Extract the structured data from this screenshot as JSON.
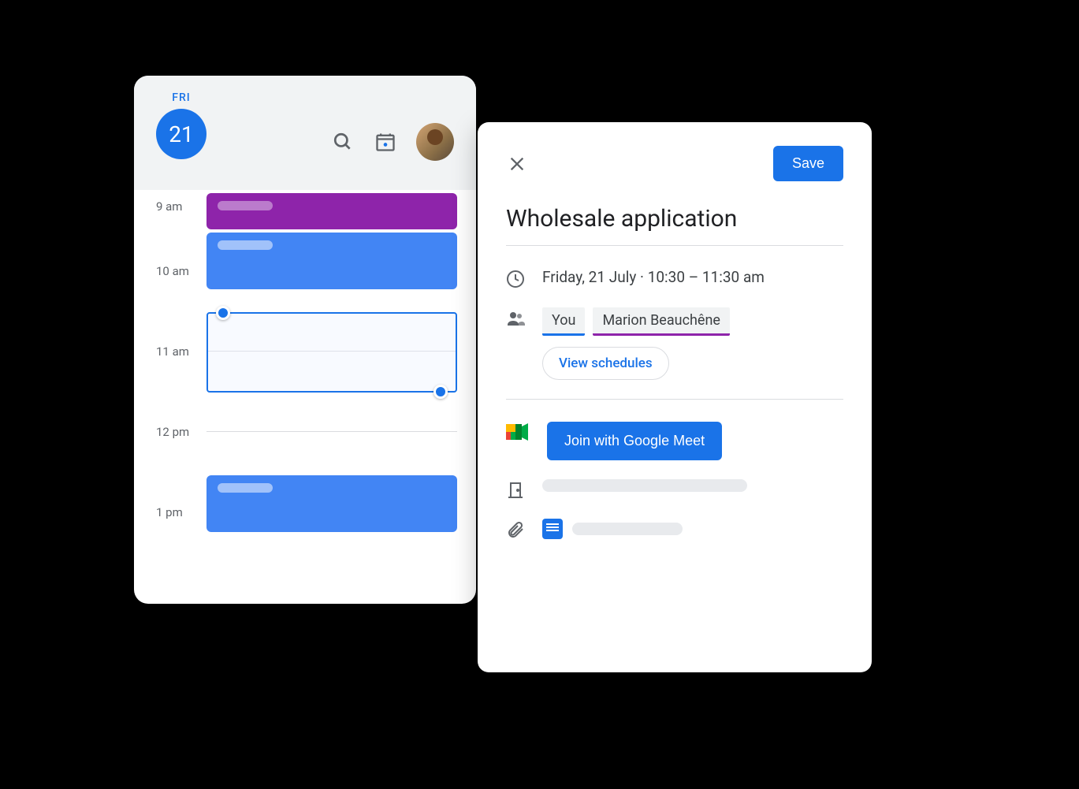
{
  "calendar": {
    "day_label": "FRI",
    "date_number": "21",
    "time_labels": [
      "9 am",
      "10 am",
      "11 am",
      "12 pm",
      "1 pm"
    ]
  },
  "event": {
    "save_label": "Save",
    "title": "Wholesale application",
    "datetime": "Friday, 21 July  ·  10:30 – 11:30 am",
    "attendees": {
      "you": "You",
      "other": "Marion Beauchêne"
    },
    "view_schedules_label": "View schedules",
    "join_meet_label": "Join with Google Meet"
  }
}
